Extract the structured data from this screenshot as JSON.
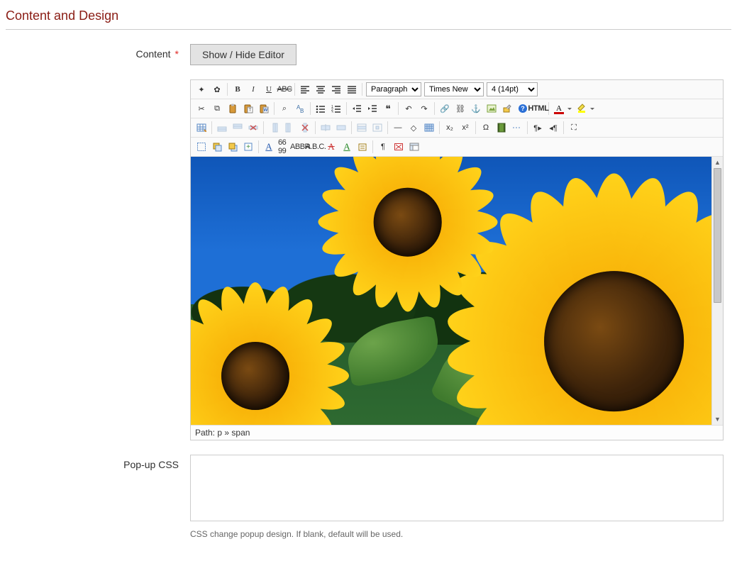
{
  "section": {
    "title": "Content and Design"
  },
  "fields": {
    "content": {
      "label": "Content"
    },
    "popup_css": {
      "label": "Pop-up CSS",
      "value": "",
      "hint": "CSS change popup design. If blank, default will be used."
    }
  },
  "buttons": {
    "toggle_editor": "Show / Hide Editor"
  },
  "editor": {
    "format": {
      "selected": "Paragraph"
    },
    "font": {
      "selected": "Times New R"
    },
    "fontsize": {
      "selected": "4 (14pt)"
    },
    "path_label": "Path:",
    "path_value": "p » span"
  },
  "glyphs": {
    "bold": "B",
    "italic": "I",
    "underline": "U",
    "strike": "ABC",
    "cut": "✂",
    "copy": "⧉",
    "help": "?",
    "html": "HTML",
    "fontA": "A",
    "sub": "x₂",
    "sup": "x²",
    "omega": "Ω",
    "pilcrow": "¶",
    "eraser": "◇",
    "quote": "❝",
    "undo": "↶",
    "redo": "↷",
    "anchor": "⚓",
    "hr": "—",
    "ltr": "¶▸",
    "rtl": "◂¶",
    "fullscreen": "⛶",
    "find": "⌕"
  }
}
